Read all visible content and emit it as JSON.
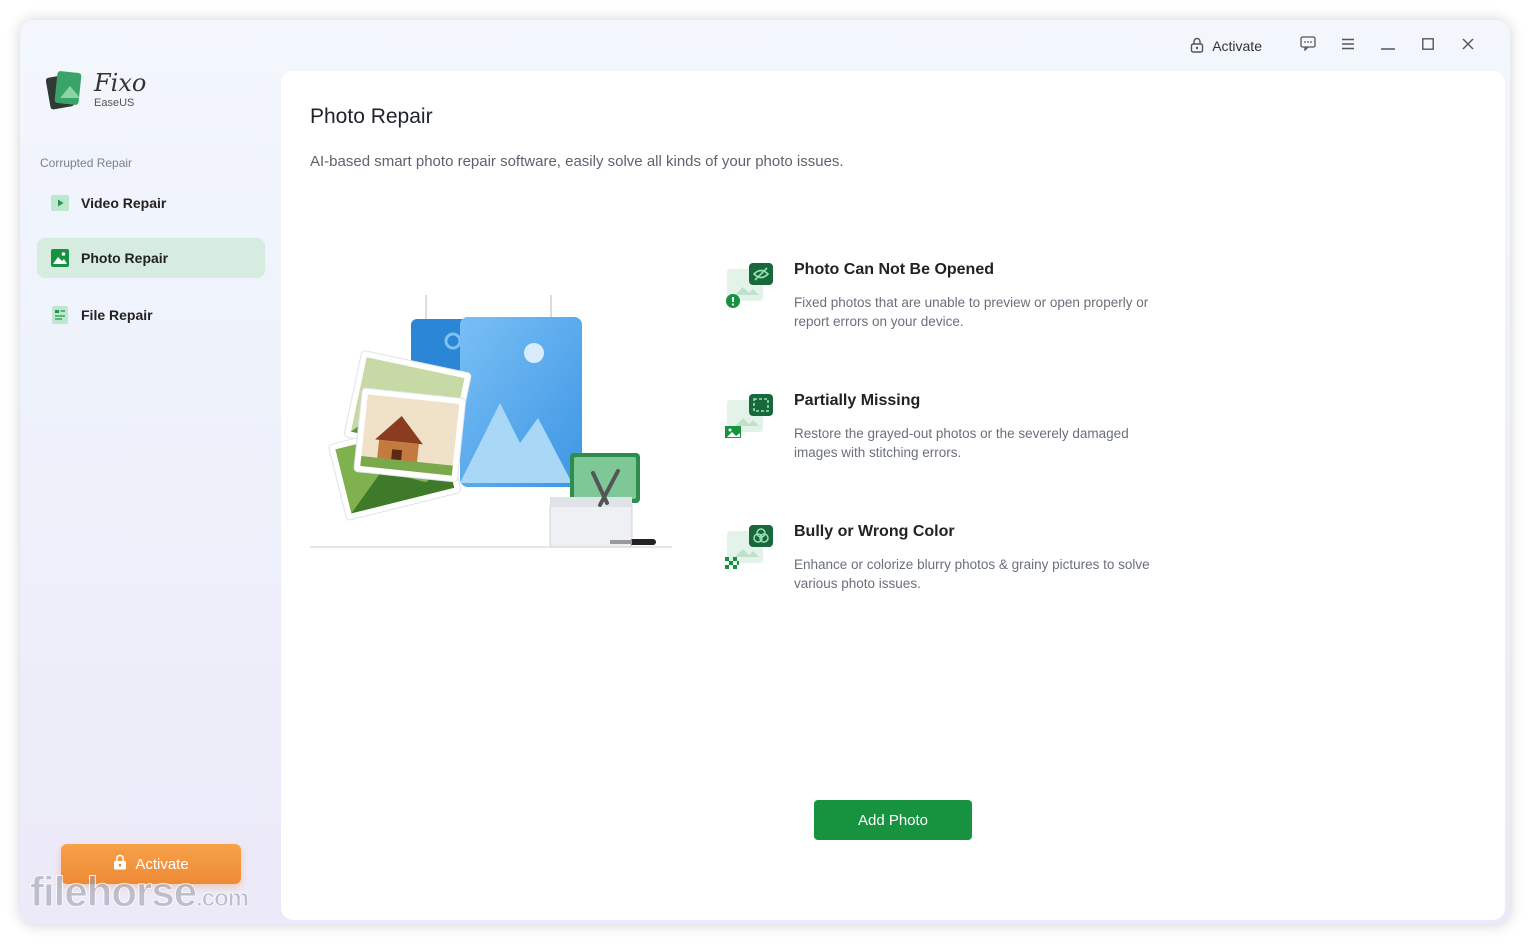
{
  "app": {
    "name": "Fixo",
    "vendor": "EaseUS"
  },
  "titlebar": {
    "activate_label": "Activate",
    "icons": [
      "lock-icon",
      "feedback-icon",
      "menu-icon",
      "minimize-icon",
      "maximize-icon",
      "close-icon"
    ]
  },
  "sidebar": {
    "section_label": "Corrupted Repair",
    "items": [
      {
        "label": "Video Repair",
        "icon": "video-icon",
        "active": false
      },
      {
        "label": "Photo Repair",
        "icon": "photo-icon",
        "active": true
      },
      {
        "label": "File Repair",
        "icon": "file-icon",
        "active": false
      }
    ],
    "activate_label": "Activate"
  },
  "main": {
    "title": "Photo Repair",
    "subtitle": "AI-based smart photo repair software, easily solve all kinds of your photo issues.",
    "features": [
      {
        "title": "Photo Can Not Be Opened",
        "desc": "Fixed photos that are unable to preview or open properly or report errors on your device."
      },
      {
        "title": "Partially Missing",
        "desc": "Restore the grayed-out photos or the severely damaged images with stitching errors."
      },
      {
        "title": "Bully or Wrong Color",
        "desc": "Enhance or colorize blurry photos & grainy pictures to solve various photo issues."
      }
    ],
    "add_button": "Add Photo"
  },
  "watermark": {
    "text": "filehorse",
    "suffix": ".com"
  },
  "colors": {
    "accent": "#17923f",
    "activate": "#ee8a36",
    "active_nav_bg": "#d6ece0"
  }
}
